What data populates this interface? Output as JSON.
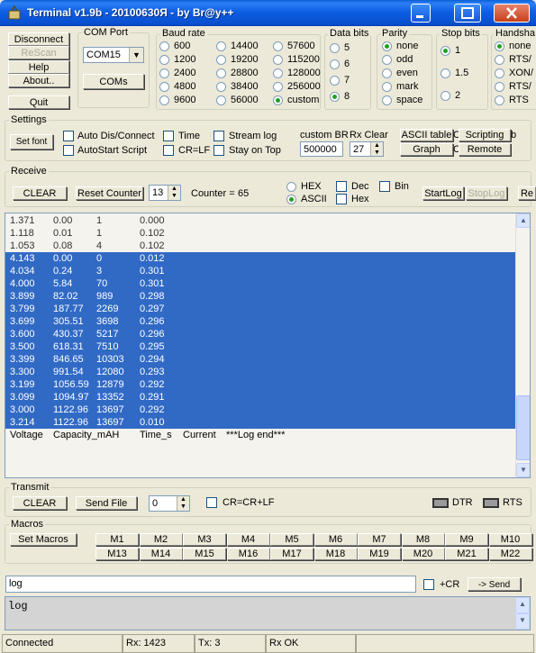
{
  "window": {
    "title": "Terminal v1.9b - 20100630Я - by Br@y++"
  },
  "left_buttons": {
    "disconnect": "Disconnect",
    "rescan": "ReScan",
    "help": "Help",
    "about": "About..",
    "quit": "Quit"
  },
  "com_port": {
    "group": "COM Port",
    "selected": "COM15",
    "coms": "COMs"
  },
  "baud": {
    "group": "Baud rate",
    "options": [
      "600",
      "1200",
      "2400",
      "4800",
      "9600",
      "14400",
      "19200",
      "28800",
      "38400",
      "56000",
      "57600",
      "115200",
      "128000",
      "256000",
      "custom"
    ],
    "selected": "custom"
  },
  "data_bits": {
    "group": "Data bits",
    "options": [
      "5",
      "6",
      "7",
      "8"
    ],
    "selected": "8"
  },
  "parity": {
    "group": "Parity",
    "options": [
      "none",
      "odd",
      "even",
      "mark",
      "space"
    ],
    "selected": "none"
  },
  "stop_bits": {
    "group": "Stop bits",
    "options": [
      "1",
      "1.5",
      "2"
    ],
    "selected": "1"
  },
  "handshake": {
    "group": "Handsha",
    "options": [
      "none",
      "RTS/",
      "XON/",
      "RTS/",
      "RTS"
    ],
    "selected": "none"
  },
  "settings": {
    "group": "Settings",
    "set_font": "Set font",
    "checks": {
      "auto_dis": "Auto Dis/Connect",
      "autostart": "AutoStart Script",
      "time": "Time",
      "crlf": "CR=LF",
      "stream": "Stream log",
      "stay": "Stay on Top"
    },
    "custom_br_label": "custom BR",
    "custom_br_value": "500000",
    "rx_clear_label": "Rx Clear",
    "rx_clear_value": "27",
    "ascii_table": "ASCII table",
    "graph": "Graph",
    "scripting": "Scripting",
    "remote": "Remote",
    "extra_c1": "C",
    "extra_c2": "C",
    "extra_b": "b"
  },
  "receive": {
    "group": "Receive",
    "clear": "CLEAR",
    "reset_counter": "Reset Counter",
    "counter_spin": "13",
    "counter_label": "Counter =",
    "counter_value": "65",
    "hex": "HEX",
    "ascii": "ASCII",
    "dec": "Dec",
    "hex2": "Hex",
    "bin": "Bin",
    "startlog": "StartLog",
    "stoplog": "StopLog",
    "re": "Re",
    "rows": [
      {
        "v": "1.371",
        "c": "0.00",
        "t": "1",
        "i": "0.000",
        "sel": false
      },
      {
        "v": "1.118",
        "c": "0.01",
        "t": "1",
        "i": "0.102",
        "sel": false
      },
      {
        "v": "1.053",
        "c": "0.08",
        "t": "4",
        "i": "0.102",
        "sel": false
      },
      {
        "v": "4.143",
        "c": "0.00",
        "t": "0",
        "i": "0.012",
        "sel": true
      },
      {
        "v": "4.034",
        "c": "0.24",
        "t": "3",
        "i": "0.301",
        "sel": true
      },
      {
        "v": "4.000",
        "c": "5.84",
        "t": "70",
        "i": "0.301",
        "sel": true
      },
      {
        "v": "3.899",
        "c": "82.02",
        "t": "989",
        "i": "0.298",
        "sel": true
      },
      {
        "v": "3.799",
        "c": "187.77",
        "t": "2269",
        "i": "0.297",
        "sel": true
      },
      {
        "v": "3.699",
        "c": "305.51",
        "t": "3698",
        "i": "0.296",
        "sel": true
      },
      {
        "v": "3.600",
        "c": "430.37",
        "t": "5217",
        "i": "0.296",
        "sel": true
      },
      {
        "v": "3.500",
        "c": "618.31",
        "t": "7510",
        "i": "0.295",
        "sel": true
      },
      {
        "v": "3.399",
        "c": "846.65",
        "t": "10303",
        "i": "0.294",
        "sel": true
      },
      {
        "v": "3.300",
        "c": "991.54",
        "t": "12080",
        "i": "0.293",
        "sel": true
      },
      {
        "v": "3.199",
        "c": "1056.59",
        "t": "12879",
        "i": "0.292",
        "sel": true
      },
      {
        "v": "3.099",
        "c": "1094.97",
        "t": "13352",
        "i": "0.291",
        "sel": true
      },
      {
        "v": "3.000",
        "c": "1122.96",
        "t": "13697",
        "i": "0.292",
        "sel": true
      },
      {
        "v": "3.214",
        "c": "1122.96",
        "t": "13697",
        "i": "0.010",
        "sel": true
      }
    ],
    "footer": {
      "v": "Voltage",
      "c": "Capacity_mAH",
      "t": "Time_s",
      "i": "Current",
      "end": "***Log end***"
    }
  },
  "transmit": {
    "group": "Transmit",
    "clear": "CLEAR",
    "send_file": "Send File",
    "spin": "0",
    "crcrlf": "CR=CR+LF",
    "dtr": "DTR",
    "rts": "RTS"
  },
  "macros": {
    "group": "Macros",
    "set_macros": "Set Macros",
    "row1": [
      "M1",
      "M2",
      "M3",
      "M4",
      "M5",
      "M6",
      "M7",
      "M8",
      "M9",
      "M10"
    ],
    "row2": [
      "M13",
      "M14",
      "M15",
      "M16",
      "M17",
      "M18",
      "M19",
      "M20",
      "M21",
      "M22"
    ]
  },
  "send": {
    "input": "log",
    "plus_cr": "+CR",
    "send": "-> Send",
    "history": "log"
  },
  "status": {
    "connected": "Connected",
    "rx": "Rx: 1423",
    "tx": "Tx: 3",
    "rxok": "Rx OK"
  },
  "colors": {
    "selection": "#316ac5",
    "titlebar": "#0a5fd6",
    "face": "#ece9d8"
  }
}
